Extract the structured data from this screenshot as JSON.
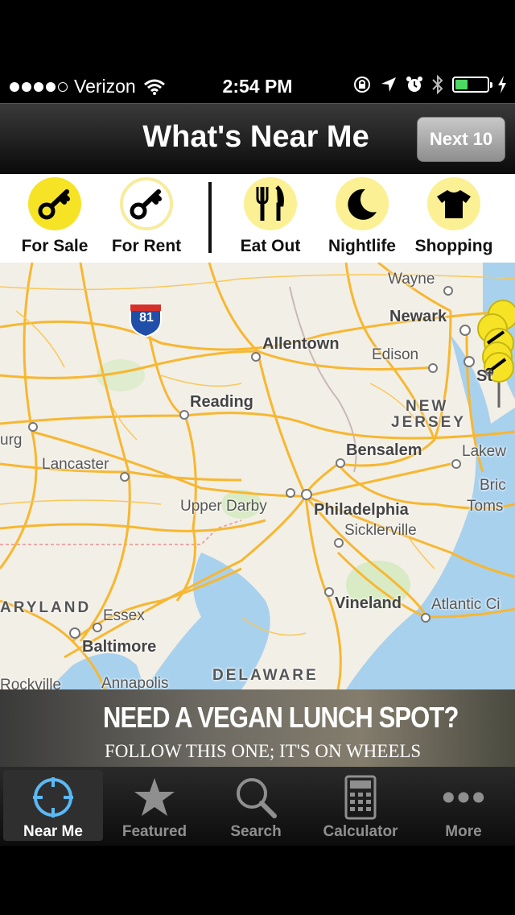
{
  "status_bar": {
    "carrier": "Verizon",
    "time": "2:54 PM"
  },
  "header": {
    "title": "What's Near Me",
    "next_button": "Next 10"
  },
  "categories": [
    {
      "label": "For Sale",
      "icon": "key-icon"
    },
    {
      "label": "For Rent",
      "icon": "key-icon"
    },
    {
      "label": "Eat Out",
      "icon": "fork-knife-icon"
    },
    {
      "label": "Nightlife",
      "icon": "moon-icon"
    },
    {
      "label": "Shopping",
      "icon": "shirt-icon"
    }
  ],
  "map": {
    "interstate_shield": "81",
    "labels": {
      "wayne": "Wayne",
      "newark": "Newark",
      "allentown": "Allentown",
      "edison": "Edison",
      "reading": "Reading",
      "new_jersey_1": "NEW",
      "new_jersey_2": "JERSEY",
      "bensalem": "Bensalem",
      "lakewood": "Lakew",
      "lancaster": "Lancaster",
      "burg": "urg",
      "brick": "Bric",
      "toms": "Toms",
      "upper_darby": "Upper Darby",
      "philadelphia": "Philadelphia",
      "sicklerville": "Sicklerville",
      "maryland": "ARYLAND",
      "essex": "Essex",
      "vineland": "Vineland",
      "atlantic_city": "Atlantic Ci",
      "baltimore": "Baltimore",
      "delaware": "DELAWARE",
      "rockville": "Rockville",
      "annapolis": "Annapolis",
      "staten": "St"
    },
    "colors": {
      "land": "#f2efe6",
      "water": "#a8d1ee",
      "road": "#f7b731",
      "pin": "#f6e325"
    }
  },
  "ad": {
    "headline": "NEED A VEGAN LUNCH SPOT?",
    "subline": "FOLLOW THIS ONE; IT'S ON WHEELS"
  },
  "tabs": [
    {
      "label": "Near Me",
      "icon": "crosshair-icon",
      "active": true
    },
    {
      "label": "Featured",
      "icon": "star-icon"
    },
    {
      "label": "Search",
      "icon": "magnifier-icon"
    },
    {
      "label": "Calculator",
      "icon": "calculator-icon"
    },
    {
      "label": "More",
      "icon": "more-dots-icon"
    }
  ]
}
